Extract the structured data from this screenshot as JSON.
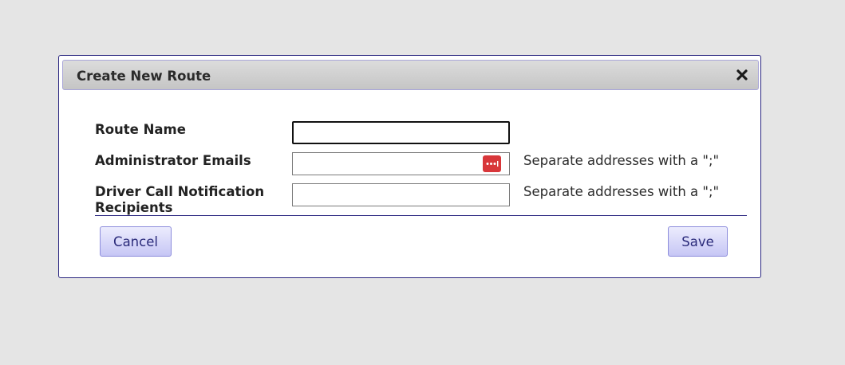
{
  "dialog": {
    "title": "Create New Route",
    "close_icon": "close-icon"
  },
  "form": {
    "route_name": {
      "label": "Route Name",
      "value": ""
    },
    "admin_emails": {
      "label": "Administrator Emails",
      "value": "",
      "hint": "Separate addresses with a \";\"",
      "autofill_icon": "password-manager-icon"
    },
    "driver_call": {
      "label_line1": "Driver Call Notification",
      "label_line2": "Recipients",
      "value": "",
      "hint": "Separate addresses with a \";\""
    }
  },
  "buttons": {
    "cancel_label": "Cancel",
    "save_label": "Save"
  },
  "colors": {
    "background": "#e5e5e5",
    "dialog_border": "#2a2680",
    "button_text": "#2a2a7a",
    "autofill_icon": "#d8373a"
  }
}
